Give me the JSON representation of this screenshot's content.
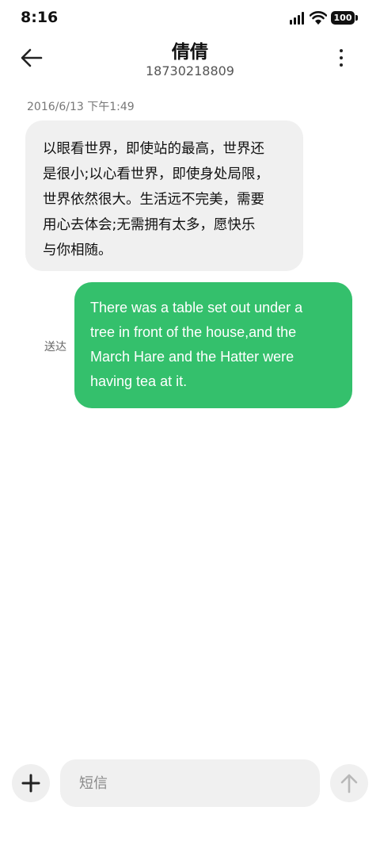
{
  "status_bar": {
    "time": "8:16",
    "battery": "100",
    "icons": [
      "signal-icon",
      "wifi-icon",
      "battery-icon"
    ]
  },
  "header": {
    "title": "倩倩",
    "subtitle": "18730218809",
    "back_icon": "arrow-left-icon",
    "more_icon": "more-vertical-icon"
  },
  "conversation": {
    "timestamp": "2016/6/13 下午1:49",
    "incoming": {
      "lines": [
        "以眼看世界，即使站的最高，世界还",
        "是很小;以心看世界，即使身处局限，",
        "世界依然很大。生活远不完美，需要",
        "用心去体会;无需拥有太多，愿快乐",
        "与你相随。"
      ]
    },
    "outgoing": {
      "lines": [
        "There was a table set out under a",
        "tree in front of the house,and the",
        "March Hare and the Hatter were",
        "having tea at it."
      ],
      "status": "送达"
    }
  },
  "composer": {
    "placeholder": "短信",
    "value": "",
    "add_icon": "plus-icon",
    "send_icon": "arrow-up-icon"
  },
  "colors": {
    "outgoing_bubble": "#34c06c",
    "incoming_bubble": "#f0f0f0",
    "background": "#ffffff"
  }
}
